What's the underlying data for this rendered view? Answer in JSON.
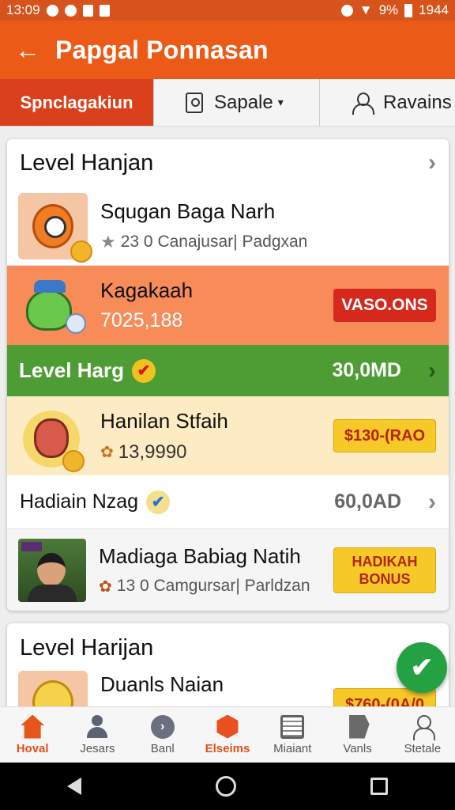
{
  "status_bar": {
    "time": "13:09",
    "battery_pct": "9%",
    "clock_right": "1944"
  },
  "app_bar": {
    "back_icon": "arrow-left-icon",
    "title": "Papgal Ponnasan"
  },
  "tabs": {
    "active_label": "Spnclagakiun",
    "sort_label": "Sapale",
    "sort_chevron": "▾",
    "rank_label": "Ravains"
  },
  "card1": {
    "header": "Level Hanjan",
    "item1": {
      "name": "Squgan Baga Narh",
      "meta": "23 0 Canajusar| Padgxan"
    },
    "item2": {
      "name": "Kagakaah",
      "value": "7025,188",
      "button": "VASO.ONS"
    },
    "level_bar": {
      "label": "Level Harg",
      "value": "30,0MD"
    },
    "item3": {
      "name": "Hanilan Stfaih",
      "value": "13,9990",
      "button": "$130-(RAO"
    },
    "level_row": {
      "label": "Hadiain Nzag",
      "value": "60,0AD"
    },
    "item4": {
      "name": "Madiaga Babiag Natih",
      "meta": "13 0 Camgursar| Parldzan",
      "button_line1": "HADIKAH",
      "button_line2": "BONUS"
    }
  },
  "card2": {
    "header": "Level Harijan",
    "item_name": "Duanls Naian",
    "button_peek": "$760-(0A/0"
  },
  "bottom_nav": [
    "Hoval",
    "Jesars",
    "Banl",
    "Elseims",
    "Miaiant",
    "Vanls",
    "Stetale"
  ],
  "colors": {
    "primary": "#ec5a17",
    "accent_red": "#d6281c",
    "green": "#4e9d34",
    "fab_green": "#24a243"
  }
}
